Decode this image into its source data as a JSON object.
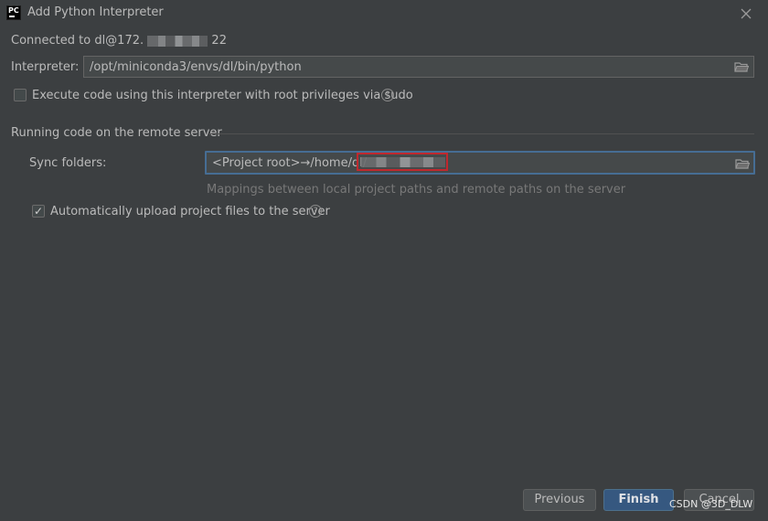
{
  "window": {
    "title": "Add Python Interpreter",
    "app_icon": "pycharm-icon",
    "close_icon": "close-icon"
  },
  "connection": {
    "prefix": "Connected to dl@172.",
    "suffix": "22"
  },
  "interpreter": {
    "label": "Interpreter:",
    "value": "/opt/miniconda3/envs/dl/bin/python"
  },
  "sudo_option": {
    "label": "Execute code using this interpreter with root privileges via sudo",
    "checked": false
  },
  "remote_section": {
    "title": "Running code on the remote server",
    "sync_label": "Sync folders:",
    "sync_value": "<Project root>→/home/dl/",
    "sync_hint": "Mappings between local project paths and remote paths on the server"
  },
  "auto_upload": {
    "label": "Automatically upload project files to the server",
    "checked": true,
    "check_glyph": "✓"
  },
  "help_glyph": "?",
  "buttons": {
    "previous": "Previous",
    "finish": "Finish",
    "cancel": "Cancel"
  },
  "watermark": "CSDN @3D_DLW",
  "colors": {
    "background": "#3c3f41",
    "focus_border": "#466d94",
    "primary_button": "#365880",
    "redaction_border": "#c0282e"
  }
}
